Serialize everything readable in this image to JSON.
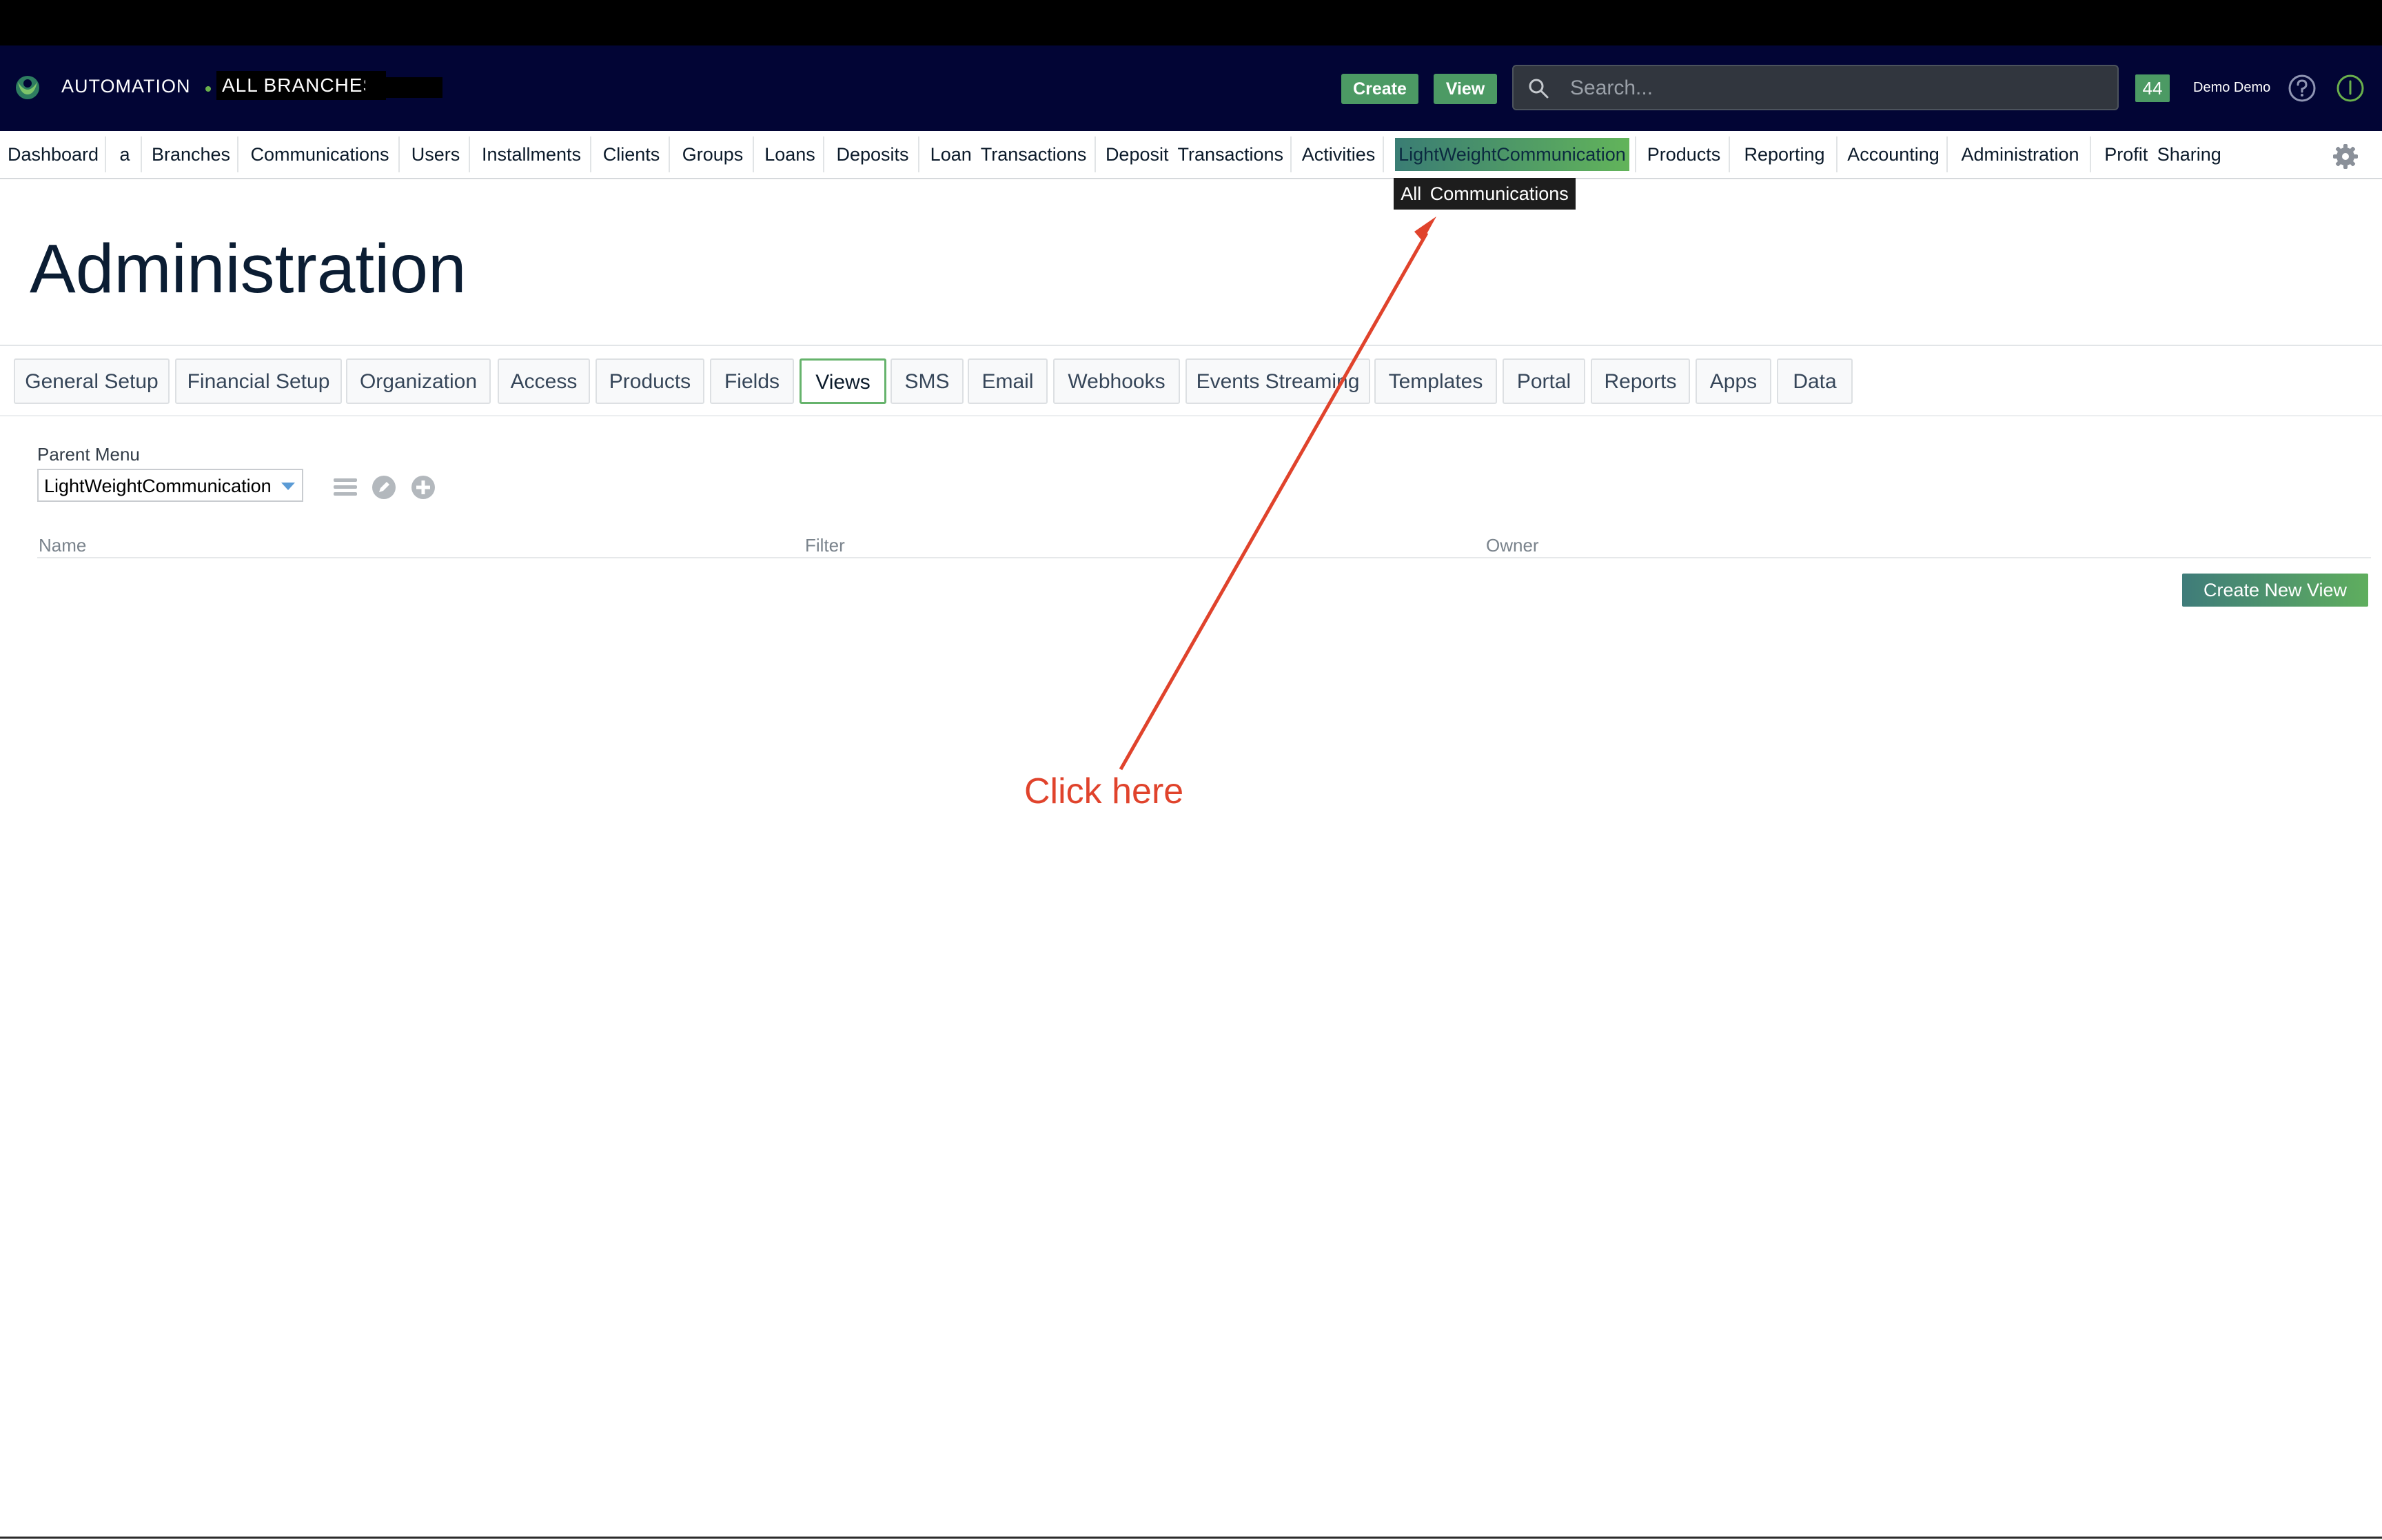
{
  "header": {
    "org_name": "AUTOMATION",
    "branch": "ALL BRANCHES",
    "create_label": "Create",
    "view_label": "View",
    "search_placeholder": "Search...",
    "notification_count": "44",
    "user_name": "Demo Demo"
  },
  "nav": {
    "items": [
      "Dashboard",
      "a",
      "Branches",
      "Communications",
      "Users",
      "Installments",
      "Clients",
      "Groups",
      "Loans",
      "Deposits",
      "Loan Transactions",
      "Deposit Transactions",
      "Activities",
      "LightWeightCommunication",
      "Products",
      "Reporting",
      "Accounting",
      "Administration",
      "Profit Sharing"
    ],
    "active": "LightWeightCommunication",
    "dropdown_item": "All Communications"
  },
  "page": {
    "title": "Administration",
    "tabs": [
      "General Setup",
      "Financial Setup",
      "Organization",
      "Access",
      "Products",
      "Fields",
      "Views",
      "SMS",
      "Email",
      "Webhooks",
      "Events Streaming",
      "Templates",
      "Portal",
      "Reports",
      "Apps",
      "Data"
    ],
    "active_tab": "Views"
  },
  "views": {
    "parent_menu_label": "Parent Menu",
    "parent_menu_value": "LightWeightCommunication",
    "columns": [
      "Name",
      "Filter",
      "Owner"
    ],
    "create_new_view_label": "Create New View"
  },
  "annotation": {
    "text": "Click here",
    "color": "#e0432c"
  },
  "colors": {
    "header_bg": "#020535",
    "accent_green": "#4c9a64"
  }
}
